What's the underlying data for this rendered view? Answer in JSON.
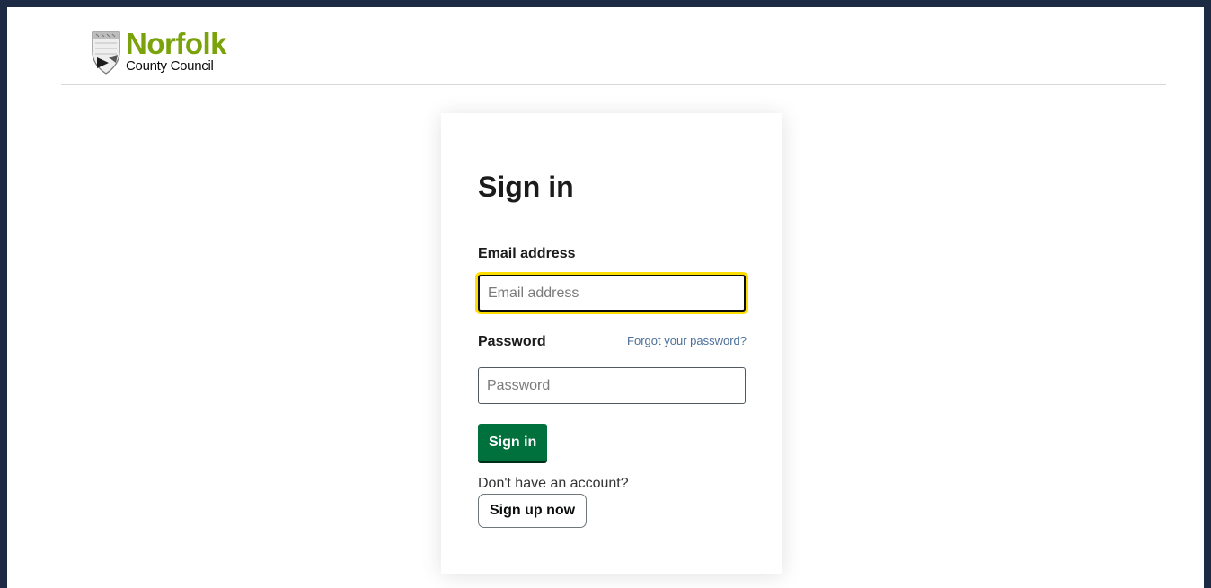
{
  "header": {
    "logo_name": "Norfolk",
    "logo_sub": "County Council"
  },
  "signin": {
    "title": "Sign in",
    "email_label": "Email address",
    "email_placeholder": "Email address",
    "password_label": "Password",
    "password_placeholder": "Password",
    "forgot_link": "Forgot your password?",
    "submit_label": "Sign in",
    "no_account_text": "Don't have an account?",
    "signup_label": "Sign up now"
  },
  "colors": {
    "brand_green": "#7aa20a",
    "button_green": "#00703c",
    "focus_yellow": "#ffdd00",
    "frame_navy": "#1d2a44",
    "link_blue": "#4a6f9a"
  },
  "icons": {
    "logo": "norfolk-crest-icon"
  }
}
